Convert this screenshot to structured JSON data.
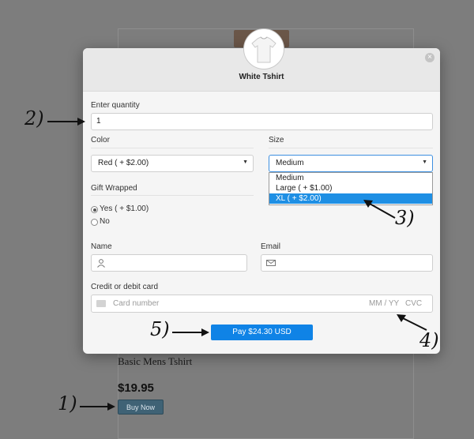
{
  "background": {
    "product_name": "Basic Mens Tshirt",
    "price": "$19.95",
    "buy_button": "Buy Now"
  },
  "modal": {
    "title": "White Tshirt",
    "close_icon": "×",
    "quantity": {
      "label": "Enter quantity",
      "value": "1"
    },
    "color": {
      "label": "Color",
      "selected": "Red ( + $2.00)"
    },
    "size": {
      "label": "Size",
      "selected": "Medium",
      "options": [
        "Medium",
        "Large ( + $1.00)",
        "XL ( + $2.00)"
      ],
      "highlighted_index": 2
    },
    "gift_wrapped": {
      "label": "Gift Wrapped",
      "options": [
        "Yes ( + $1.00)",
        "No"
      ],
      "selected_index": 0
    },
    "name": {
      "label": "Name",
      "icon": "user-icon"
    },
    "email": {
      "label": "Email",
      "icon": "envelope-icon"
    },
    "card": {
      "label": "Credit or debit card",
      "number_placeholder": "Card number",
      "expiry_placeholder": "MM / YY",
      "cvc_placeholder": "CVC",
      "icon": "credit-card-icon"
    },
    "pay_button": "Pay $24.30 USD"
  },
  "annotations": [
    "1)",
    "2)",
    "3)",
    "4)",
    "5)"
  ],
  "colors": {
    "overlay": "#7d7d7d",
    "pay_button": "#0f83e6",
    "dropdown_highlight": "#1e8fe4",
    "buy_button": "#3f6275"
  }
}
